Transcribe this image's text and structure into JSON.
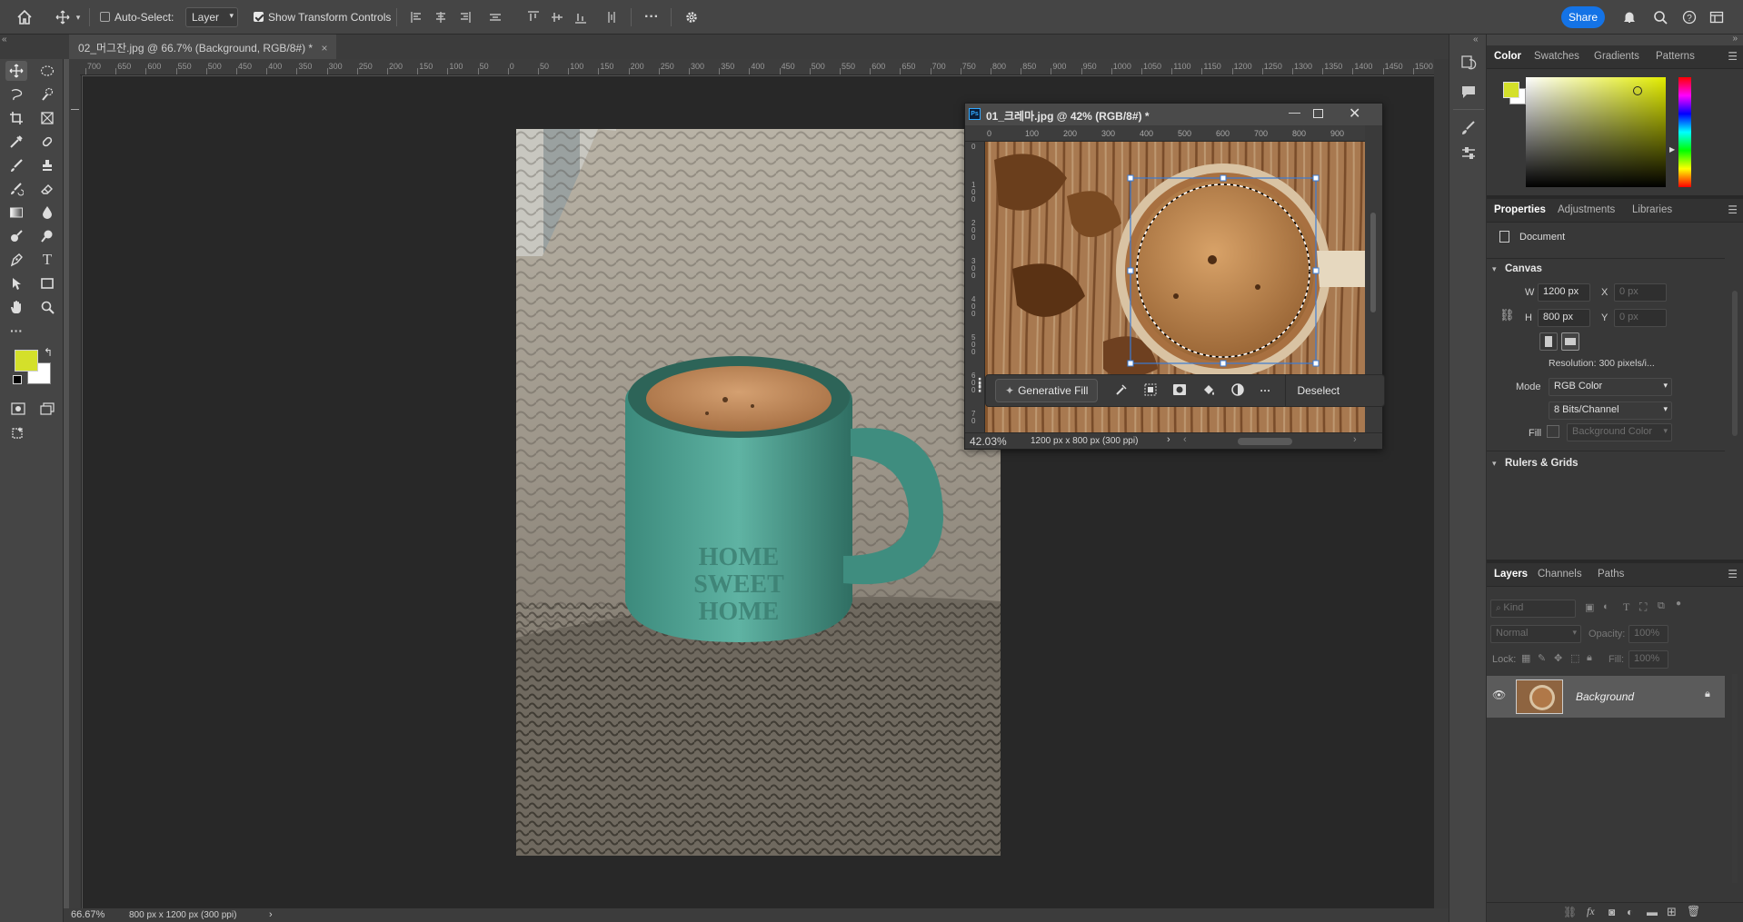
{
  "options_bar": {
    "auto_select_label": "Auto-Select:",
    "auto_select_checked": false,
    "layer_dropdown": "Layer",
    "show_transform_label": "Show Transform Controls",
    "show_transform_checked": true,
    "share_label": "Share"
  },
  "tab": {
    "title": "02_머그잔.jpg @ 66.7% (Background, RGB/8#) *",
    "close": "×"
  },
  "rulers": {
    "horizontal_ticks": [
      "700",
      "650",
      "600",
      "550",
      "500",
      "450",
      "400",
      "350",
      "300",
      "250",
      "200",
      "150",
      "100",
      "50",
      "0",
      "50",
      "100",
      "150",
      "200",
      "250",
      "300",
      "350",
      "400",
      "450",
      "500",
      "550",
      "600",
      "650",
      "700",
      "750",
      "800",
      "850",
      "900",
      "950",
      "1000",
      "1050",
      "1100",
      "1150",
      "1200",
      "1250",
      "1300",
      "1350",
      "1400",
      "1450",
      "1500"
    ]
  },
  "status_bar": {
    "zoom": "66.67%",
    "doc_size": "800 px x 1200 px (300 ppi)",
    "arrow": "›"
  },
  "float_window": {
    "title": "01_크레마.jpg @ 42% (RGB/8#) *",
    "ruler_ticks": [
      "0",
      "100",
      "200",
      "300",
      "400",
      "500",
      "600",
      "700",
      "800",
      "900"
    ],
    "vruler_ticks": [
      "0",
      "1 0 0",
      "2 0 0",
      "3 0 0",
      "4 0 0",
      "5 0 0",
      "6 0 0",
      "7 0"
    ],
    "zoom": "42.03%",
    "doc_size": "1200 px x 800 px (300 ppi)",
    "generative_fill": "Generative Fill",
    "deselect": "Deselect"
  },
  "color_panel": {
    "tabs": [
      "Color",
      "Swatches",
      "Gradients",
      "Patterns"
    ],
    "foreground": "#d4e02a",
    "background": "#ffffff"
  },
  "properties_panel": {
    "tabs": [
      "Properties",
      "Adjustments",
      "Libraries"
    ],
    "doc_label": "Document",
    "canvas_header": "Canvas",
    "w_label": "W",
    "w_value": "1200 px",
    "h_label": "H",
    "h_value": "800 px",
    "x_label": "X",
    "x_value": "0 px",
    "y_label": "Y",
    "y_value": "0 px",
    "resolution": "Resolution: 300 pixels/i...",
    "mode_label": "Mode",
    "mode_value": "RGB Color",
    "bits_value": "8 Bits/Channel",
    "fill_label": "Fill",
    "fill_value": "Background Color",
    "rulers_header": "Rulers & Grids"
  },
  "layers_panel": {
    "tabs": [
      "Layers",
      "Channels",
      "Paths"
    ],
    "kind_placeholder": "Kind",
    "blend_mode": "Normal",
    "opacity_label": "Opacity:",
    "opacity_value": "100%",
    "lock_label": "Lock:",
    "fill_label": "Fill:",
    "fill_value": "100%",
    "layer_name": "Background"
  }
}
